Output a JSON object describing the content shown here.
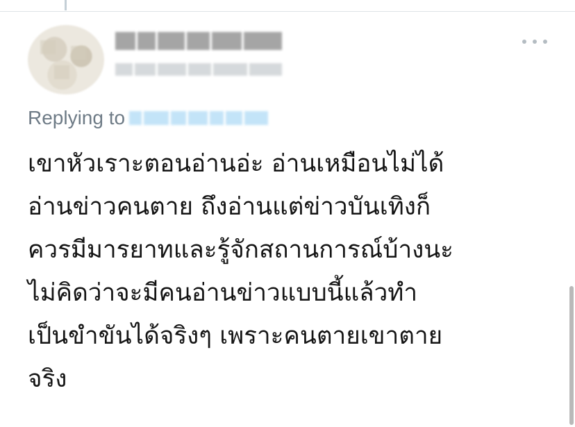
{
  "thread": {
    "show_connector": true
  },
  "author": {
    "avatar_icon": "blurred-avatar",
    "display_name_redacted": true,
    "handle_redacted": true
  },
  "menu": {
    "more_icon": "more-horizontal-icon"
  },
  "reply": {
    "label": "Replying to",
    "handle_redacted": true
  },
  "tweet": {
    "lines": [
      "เขาหัวเราะตอนอ่านอ่ะ อ่านเหมือนไม่ได้",
      "อ่านข่าวคนตาย ถึงอ่านแต่ข่าวบันเทิงก็",
      "ควรมีมารยาทและรู้จักสถานการณ์บ้างนะ",
      "ไม่คิดว่าจะมีคนอ่านข่าวแบบนี้แล้วทำ",
      "เป็นขำขันได้จริงๆ เพราะคนตายเขาตาย",
      "จริง"
    ]
  },
  "colors": {
    "text": "#141414",
    "secondary": "#6e7b86",
    "link": "#1d9bf0",
    "divider": "#dfe3e6"
  }
}
